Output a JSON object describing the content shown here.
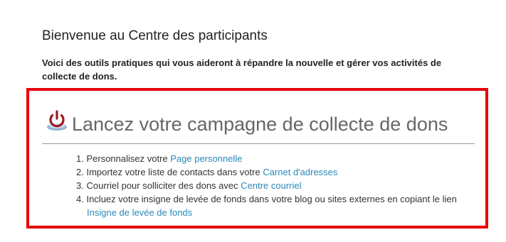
{
  "header": {
    "title": "Bienvenue au Centre des participants",
    "intro": "Voici des outils pratiques qui vous aideront à répandre la nouvelle et gérer vos activités de collecte de dons."
  },
  "campaign": {
    "icon": "power-icon",
    "title": "Lancez votre campagne de collecte de dons",
    "accent_color": "#e8000b",
    "link_color": "#2a8ab8",
    "steps": [
      {
        "number": "1.",
        "text": "Personnalisez votre ",
        "link": "Page personnelle"
      },
      {
        "number": "2.",
        "text": "Importez votre liste de contacts dans votre ",
        "link": "Carnet d'adresses"
      },
      {
        "number": "3.",
        "text": "Courriel pour solliciter des dons avec ",
        "link": "Centre courriel"
      },
      {
        "number": "4.",
        "text": "Incluez votre insigne de levée de fonds dans votre blog ou sites externes en copiant le lien",
        "link": "Insigne de levée de fonds"
      }
    ]
  }
}
